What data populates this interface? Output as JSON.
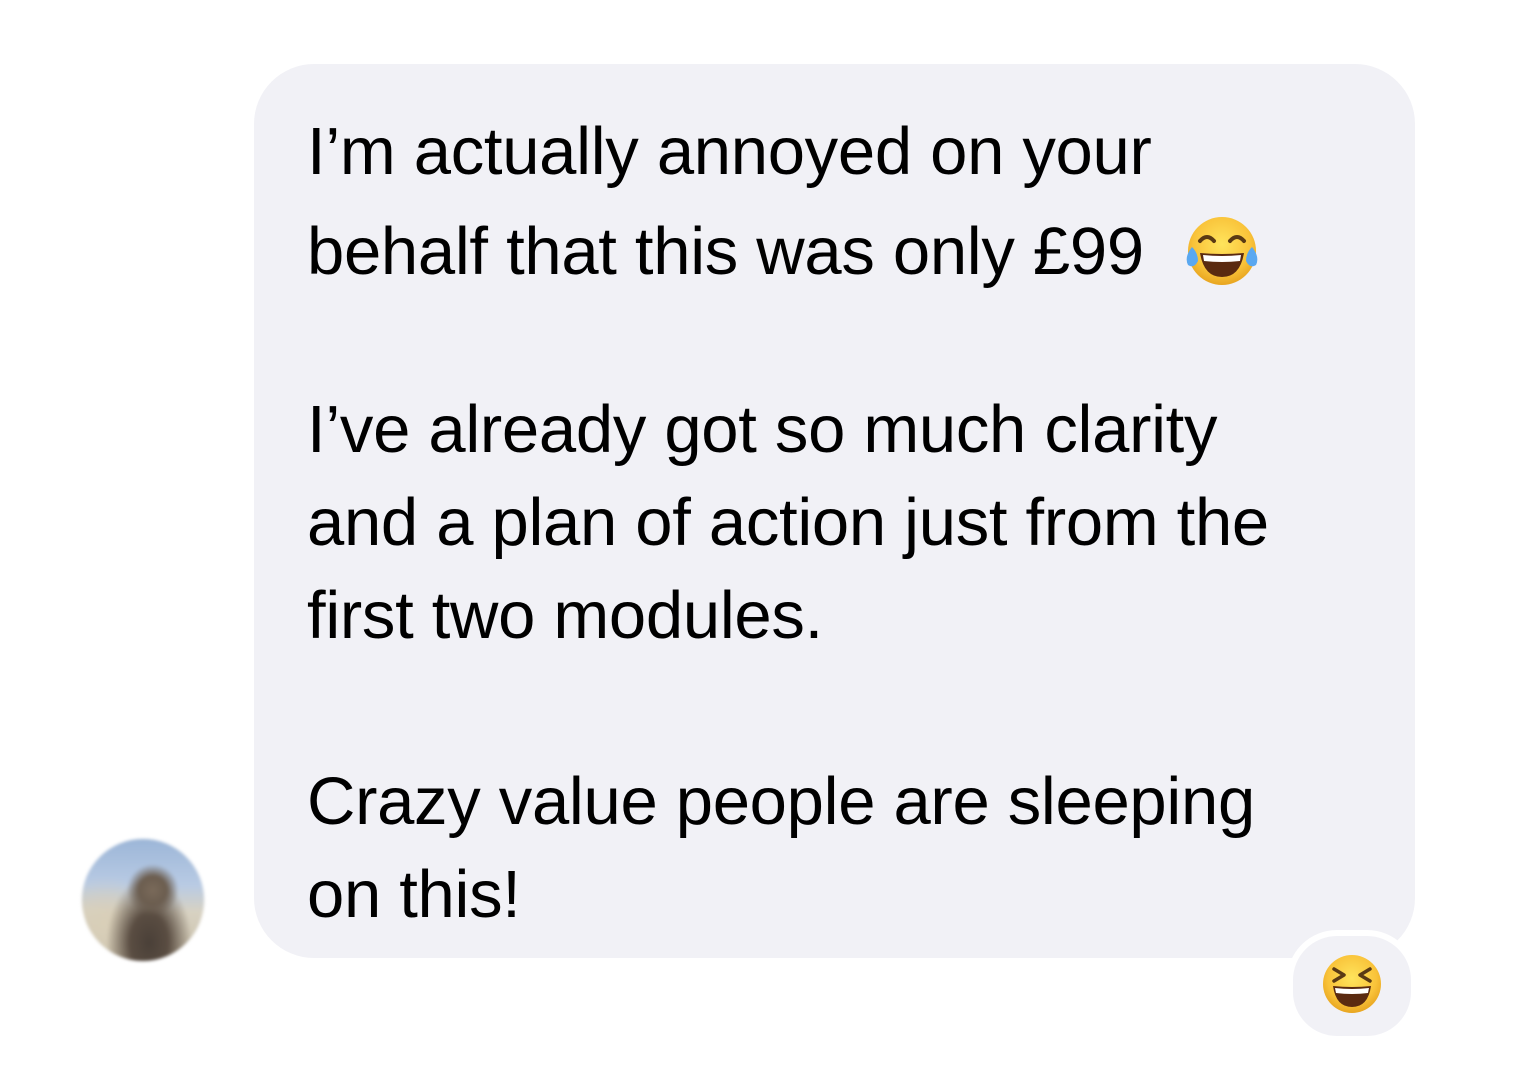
{
  "message": {
    "lines": [
      "I’m actually annoyed on your",
      "behalf that this was only £99",
      " I’ve already got so much clarity",
      "and a plan of action just from the",
      "first two modules.",
      "Crazy value people are sleeping",
      "on this!"
    ],
    "inline_emoji": "face-with-tears-of-joy-icon"
  },
  "reaction": {
    "emoji": "grinning-squinting-face-icon"
  },
  "colors": {
    "bubble_bg": "#f1f1f6",
    "text": "#000000",
    "emoji_yellow": "#f7c23a"
  }
}
